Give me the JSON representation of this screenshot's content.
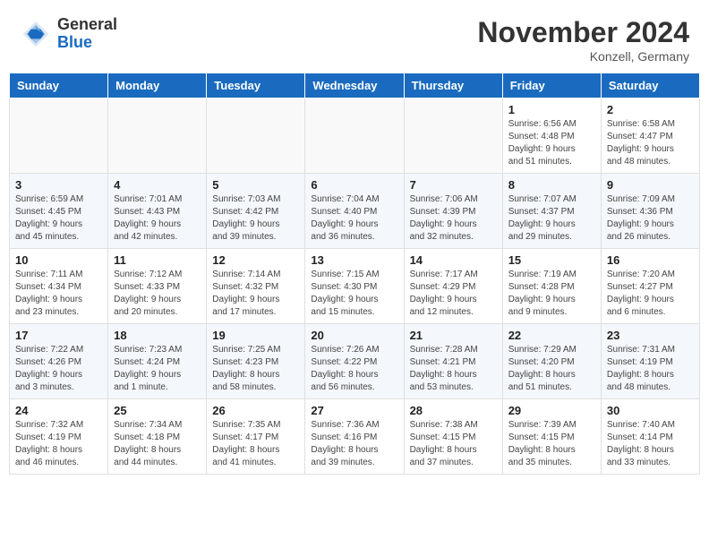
{
  "logo": {
    "general": "General",
    "blue": "Blue"
  },
  "header": {
    "month": "November 2024",
    "location": "Konzell, Germany"
  },
  "days_of_week": [
    "Sunday",
    "Monday",
    "Tuesday",
    "Wednesday",
    "Thursday",
    "Friday",
    "Saturday"
  ],
  "weeks": [
    [
      {
        "day": "",
        "info": "",
        "empty": true
      },
      {
        "day": "",
        "info": "",
        "empty": true
      },
      {
        "day": "",
        "info": "",
        "empty": true
      },
      {
        "day": "",
        "info": "",
        "empty": true
      },
      {
        "day": "",
        "info": "",
        "empty": true
      },
      {
        "day": "1",
        "info": "Sunrise: 6:56 AM\nSunset: 4:48 PM\nDaylight: 9 hours\nand 51 minutes."
      },
      {
        "day": "2",
        "info": "Sunrise: 6:58 AM\nSunset: 4:47 PM\nDaylight: 9 hours\nand 48 minutes."
      }
    ],
    [
      {
        "day": "3",
        "info": "Sunrise: 6:59 AM\nSunset: 4:45 PM\nDaylight: 9 hours\nand 45 minutes."
      },
      {
        "day": "4",
        "info": "Sunrise: 7:01 AM\nSunset: 4:43 PM\nDaylight: 9 hours\nand 42 minutes."
      },
      {
        "day": "5",
        "info": "Sunrise: 7:03 AM\nSunset: 4:42 PM\nDaylight: 9 hours\nand 39 minutes."
      },
      {
        "day": "6",
        "info": "Sunrise: 7:04 AM\nSunset: 4:40 PM\nDaylight: 9 hours\nand 36 minutes."
      },
      {
        "day": "7",
        "info": "Sunrise: 7:06 AM\nSunset: 4:39 PM\nDaylight: 9 hours\nand 32 minutes."
      },
      {
        "day": "8",
        "info": "Sunrise: 7:07 AM\nSunset: 4:37 PM\nDaylight: 9 hours\nand 29 minutes."
      },
      {
        "day": "9",
        "info": "Sunrise: 7:09 AM\nSunset: 4:36 PM\nDaylight: 9 hours\nand 26 minutes."
      }
    ],
    [
      {
        "day": "10",
        "info": "Sunrise: 7:11 AM\nSunset: 4:34 PM\nDaylight: 9 hours\nand 23 minutes."
      },
      {
        "day": "11",
        "info": "Sunrise: 7:12 AM\nSunset: 4:33 PM\nDaylight: 9 hours\nand 20 minutes."
      },
      {
        "day": "12",
        "info": "Sunrise: 7:14 AM\nSunset: 4:32 PM\nDaylight: 9 hours\nand 17 minutes."
      },
      {
        "day": "13",
        "info": "Sunrise: 7:15 AM\nSunset: 4:30 PM\nDaylight: 9 hours\nand 15 minutes."
      },
      {
        "day": "14",
        "info": "Sunrise: 7:17 AM\nSunset: 4:29 PM\nDaylight: 9 hours\nand 12 minutes."
      },
      {
        "day": "15",
        "info": "Sunrise: 7:19 AM\nSunset: 4:28 PM\nDaylight: 9 hours\nand 9 minutes."
      },
      {
        "day": "16",
        "info": "Sunrise: 7:20 AM\nSunset: 4:27 PM\nDaylight: 9 hours\nand 6 minutes."
      }
    ],
    [
      {
        "day": "17",
        "info": "Sunrise: 7:22 AM\nSunset: 4:26 PM\nDaylight: 9 hours\nand 3 minutes."
      },
      {
        "day": "18",
        "info": "Sunrise: 7:23 AM\nSunset: 4:24 PM\nDaylight: 9 hours\nand 1 minute."
      },
      {
        "day": "19",
        "info": "Sunrise: 7:25 AM\nSunset: 4:23 PM\nDaylight: 8 hours\nand 58 minutes."
      },
      {
        "day": "20",
        "info": "Sunrise: 7:26 AM\nSunset: 4:22 PM\nDaylight: 8 hours\nand 56 minutes."
      },
      {
        "day": "21",
        "info": "Sunrise: 7:28 AM\nSunset: 4:21 PM\nDaylight: 8 hours\nand 53 minutes."
      },
      {
        "day": "22",
        "info": "Sunrise: 7:29 AM\nSunset: 4:20 PM\nDaylight: 8 hours\nand 51 minutes."
      },
      {
        "day": "23",
        "info": "Sunrise: 7:31 AM\nSunset: 4:19 PM\nDaylight: 8 hours\nand 48 minutes."
      }
    ],
    [
      {
        "day": "24",
        "info": "Sunrise: 7:32 AM\nSunset: 4:19 PM\nDaylight: 8 hours\nand 46 minutes."
      },
      {
        "day": "25",
        "info": "Sunrise: 7:34 AM\nSunset: 4:18 PM\nDaylight: 8 hours\nand 44 minutes."
      },
      {
        "day": "26",
        "info": "Sunrise: 7:35 AM\nSunset: 4:17 PM\nDaylight: 8 hours\nand 41 minutes."
      },
      {
        "day": "27",
        "info": "Sunrise: 7:36 AM\nSunset: 4:16 PM\nDaylight: 8 hours\nand 39 minutes."
      },
      {
        "day": "28",
        "info": "Sunrise: 7:38 AM\nSunset: 4:15 PM\nDaylight: 8 hours\nand 37 minutes."
      },
      {
        "day": "29",
        "info": "Sunrise: 7:39 AM\nSunset: 4:15 PM\nDaylight: 8 hours\nand 35 minutes."
      },
      {
        "day": "30",
        "info": "Sunrise: 7:40 AM\nSunset: 4:14 PM\nDaylight: 8 hours\nand 33 minutes."
      }
    ]
  ]
}
